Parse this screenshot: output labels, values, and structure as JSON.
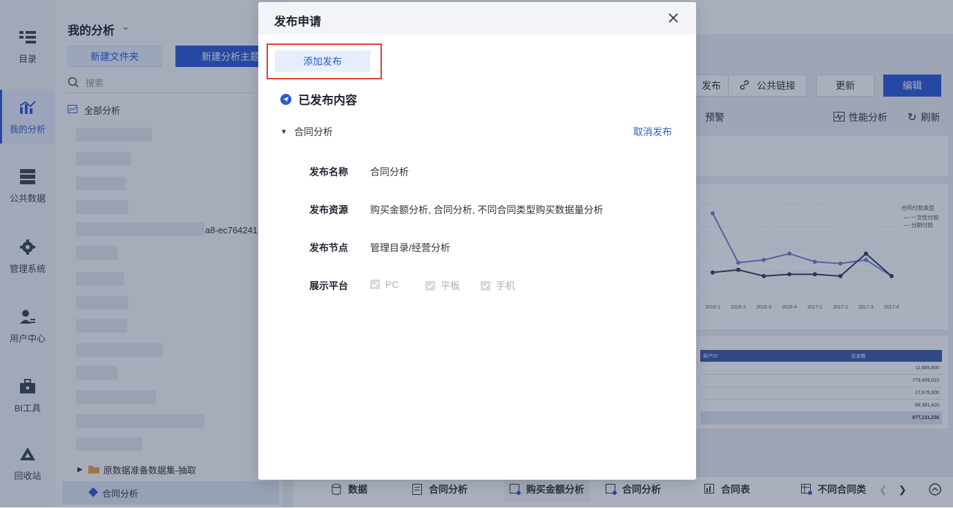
{
  "nav": {
    "items": [
      {
        "label": "目录",
        "icon": "catalog-icon"
      },
      {
        "label": "我的分析",
        "icon": "analysis-icon",
        "active": true
      },
      {
        "label": "公共数据",
        "icon": "database-icon"
      },
      {
        "label": "管理系统",
        "icon": "gear-icon"
      },
      {
        "label": "用户中心",
        "icon": "user-icon"
      },
      {
        "label": "BI工具",
        "icon": "toolbox-icon"
      },
      {
        "label": "回收站",
        "icon": "recycle-icon"
      }
    ]
  },
  "panel": {
    "title": "我的分析",
    "new_folder": "新建文件夹",
    "new_topic": "新建分析主题",
    "search_placeholder": "搜索",
    "root": "全部分析",
    "partial_id": "a8-ec764241",
    "folder_item": "原数据准备数据集-抽取",
    "selected_item": "合同分析"
  },
  "toolbar": {
    "publish_partial": "发布",
    "public_link": "公共链接",
    "update": "更新",
    "edit": "编辑",
    "alert_partial": "预警",
    "performance": "性能分析",
    "refresh": "刷新"
  },
  "chart_data": {
    "type": "line",
    "categories": [
      "2016-1",
      "2016-2",
      "2016-3",
      "2016-4",
      "2017-1",
      "2017-2",
      "2017-3",
      "2017-4"
    ],
    "legend_title": "合同付款类型",
    "series": [
      {
        "name": "一次性付款",
        "values": [
          0.9,
          0.35,
          0.38,
          0.45,
          0.36,
          0.34,
          0.38,
          0.2
        ]
      },
      {
        "name": "分期付款",
        "values": [
          0.24,
          0.27,
          0.2,
          0.22,
          0.22,
          0.2,
          0.45,
          0.2
        ]
      }
    ],
    "colors": [
      "#6e83d8",
      "#2d3a66"
    ]
  },
  "table": {
    "headers": [
      "客户ID",
      "总金额"
    ],
    "rows": [
      "11,665,800",
      "779,409,010",
      "17,675,000",
      "68,381,420"
    ],
    "total": "877,131,230"
  },
  "bottom_tabs": [
    "数据",
    "合同分析",
    "购买金额分析",
    "合同分析",
    "合同表",
    "不同合同类"
  ],
  "modal": {
    "title": "发布申请",
    "add_button": "添加发布",
    "section_title": "已发布内容",
    "group_name": "合同分析",
    "cancel_publish": "取消发布",
    "fields": [
      {
        "label": "发布名称",
        "value": "合同分析"
      },
      {
        "label": "发布资源",
        "value": "购买金额分析, 合同分析, 不同合同类型购买数据量分析"
      },
      {
        "label": "发布节点",
        "value": "管理目录/经营分析"
      }
    ],
    "platform_label": "展示平台",
    "platforms": [
      "PC",
      "平板",
      "手机"
    ]
  }
}
